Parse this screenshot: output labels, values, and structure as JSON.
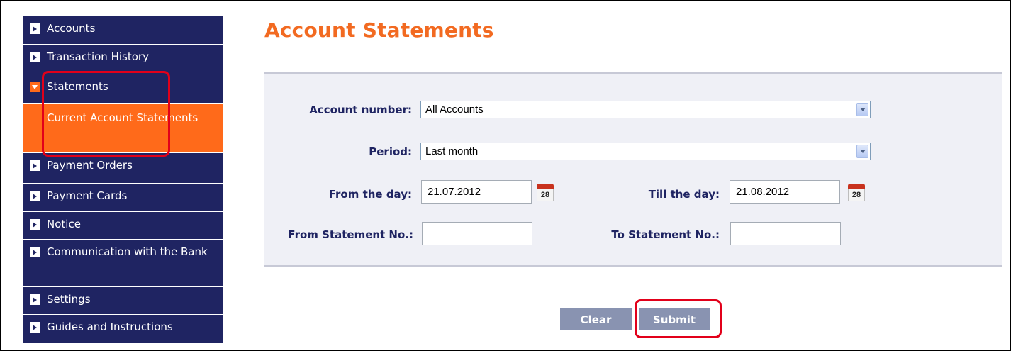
{
  "sidebar": {
    "items": [
      {
        "label": "Accounts"
      },
      {
        "label": "Transaction History"
      },
      {
        "label": "Statements"
      },
      {
        "label": "Payment Orders"
      },
      {
        "label": "Payment Cards"
      },
      {
        "label": "Notice"
      },
      {
        "label": "Communication with the Bank"
      },
      {
        "label": "Settings"
      },
      {
        "label": "Guides and Instructions"
      }
    ],
    "sub_item": {
      "label": "Current Account Statements"
    }
  },
  "page": {
    "title": "Account Statements"
  },
  "form": {
    "account_number": {
      "label": "Account number:",
      "value": "All Accounts"
    },
    "period": {
      "label": "Period:",
      "value": "Last month"
    },
    "from_day": {
      "label": "From the day:",
      "value": "21.07.2012"
    },
    "till_day": {
      "label": "Till the day:",
      "value": "21.08.2012"
    },
    "from_statement": {
      "label": "From Statement No.:",
      "value": ""
    },
    "to_statement": {
      "label": "To Statement No.:",
      "value": ""
    },
    "calendar_day": "28"
  },
  "buttons": {
    "clear": "Clear",
    "submit": "Submit"
  },
  "colors": {
    "nav": "#1f2462",
    "accent": "#ff6a1a",
    "title": "#f26a21",
    "highlight": "#e2001a"
  }
}
